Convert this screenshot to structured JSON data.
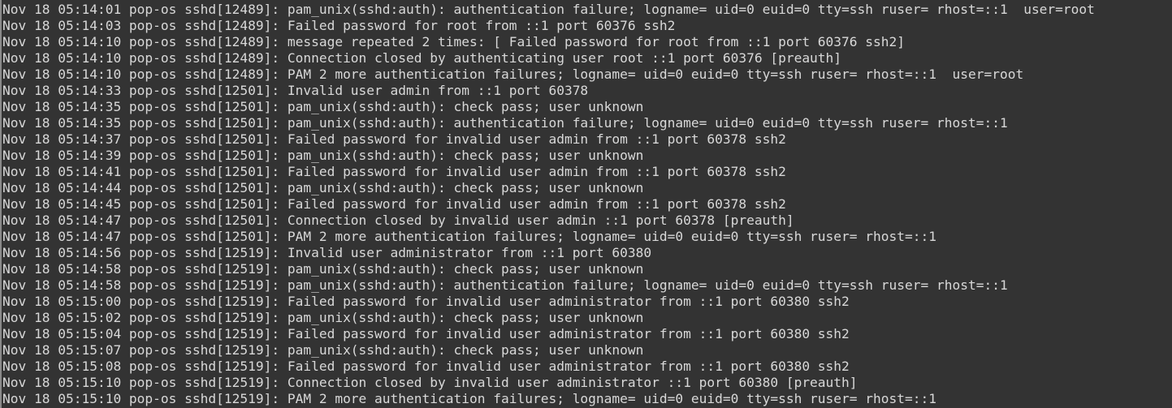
{
  "terminal": {
    "lines": [
      "Nov 18 05:14:01 pop-os sshd[12489]: pam_unix(sshd:auth): authentication failure; logname= uid=0 euid=0 tty=ssh ruser= rhost=::1  user=root",
      "Nov 18 05:14:03 pop-os sshd[12489]: Failed password for root from ::1 port 60376 ssh2",
      "Nov 18 05:14:10 pop-os sshd[12489]: message repeated 2 times: [ Failed password for root from ::1 port 60376 ssh2]",
      "Nov 18 05:14:10 pop-os sshd[12489]: Connection closed by authenticating user root ::1 port 60376 [preauth]",
      "Nov 18 05:14:10 pop-os sshd[12489]: PAM 2 more authentication failures; logname= uid=0 euid=0 tty=ssh ruser= rhost=::1  user=root",
      "Nov 18 05:14:33 pop-os sshd[12501]: Invalid user admin from ::1 port 60378",
      "Nov 18 05:14:35 pop-os sshd[12501]: pam_unix(sshd:auth): check pass; user unknown",
      "Nov 18 05:14:35 pop-os sshd[12501]: pam_unix(sshd:auth): authentication failure; logname= uid=0 euid=0 tty=ssh ruser= rhost=::1",
      "Nov 18 05:14:37 pop-os sshd[12501]: Failed password for invalid user admin from ::1 port 60378 ssh2",
      "Nov 18 05:14:39 pop-os sshd[12501]: pam_unix(sshd:auth): check pass; user unknown",
      "Nov 18 05:14:41 pop-os sshd[12501]: Failed password for invalid user admin from ::1 port 60378 ssh2",
      "Nov 18 05:14:44 pop-os sshd[12501]: pam_unix(sshd:auth): check pass; user unknown",
      "Nov 18 05:14:45 pop-os sshd[12501]: Failed password for invalid user admin from ::1 port 60378 ssh2",
      "Nov 18 05:14:47 pop-os sshd[12501]: Connection closed by invalid user admin ::1 port 60378 [preauth]",
      "Nov 18 05:14:47 pop-os sshd[12501]: PAM 2 more authentication failures; logname= uid=0 euid=0 tty=ssh ruser= rhost=::1",
      "Nov 18 05:14:56 pop-os sshd[12519]: Invalid user administrator from ::1 port 60380",
      "Nov 18 05:14:58 pop-os sshd[12519]: pam_unix(sshd:auth): check pass; user unknown",
      "Nov 18 05:14:58 pop-os sshd[12519]: pam_unix(sshd:auth): authentication failure; logname= uid=0 euid=0 tty=ssh ruser= rhost=::1",
      "Nov 18 05:15:00 pop-os sshd[12519]: Failed password for invalid user administrator from ::1 port 60380 ssh2",
      "Nov 18 05:15:02 pop-os sshd[12519]: pam_unix(sshd:auth): check pass; user unknown",
      "Nov 18 05:15:04 pop-os sshd[12519]: Failed password for invalid user administrator from ::1 port 60380 ssh2",
      "Nov 18 05:15:07 pop-os sshd[12519]: pam_unix(sshd:auth): check pass; user unknown",
      "Nov 18 05:15:08 pop-os sshd[12519]: Failed password for invalid user administrator from ::1 port 60380 ssh2",
      "Nov 18 05:15:10 pop-os sshd[12519]: Connection closed by invalid user administrator ::1 port 60380 [preauth]",
      "Nov 18 05:15:10 pop-os sshd[12519]: PAM 2 more authentication failures; logname= uid=0 euid=0 tty=ssh ruser= rhost=::1"
    ],
    "colors": {
      "background": "#333333",
      "text": "#d8d8d8",
      "left_rule": "#8a8a8a"
    }
  }
}
